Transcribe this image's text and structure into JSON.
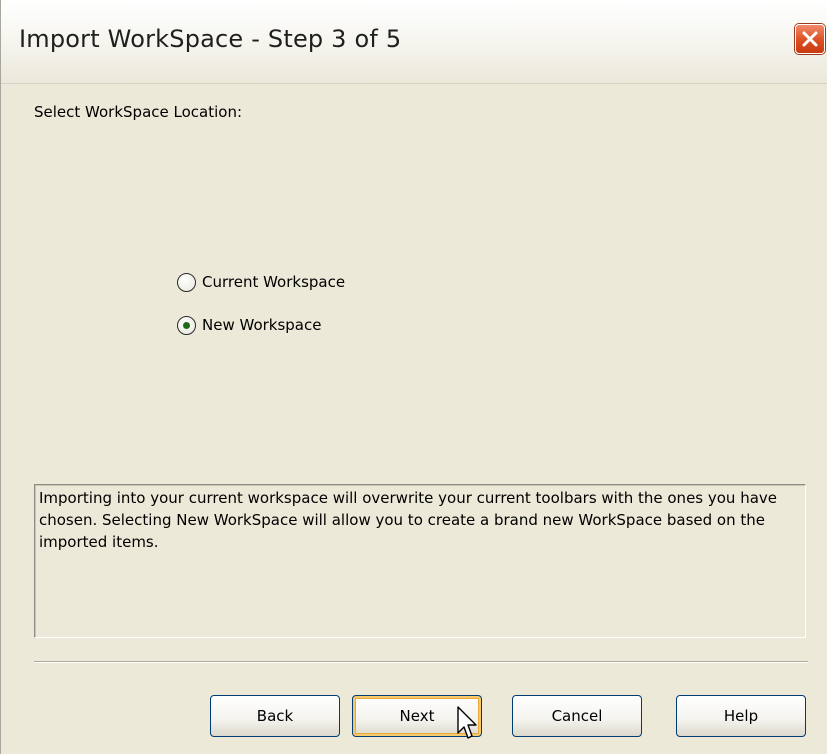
{
  "window": {
    "title": "Import WorkSpace - Step 3 of 5",
    "close_icon": "close-icon"
  },
  "prompt": "Select WorkSpace Location:",
  "location_options": [
    {
      "label": "Current Workspace",
      "selected": false
    },
    {
      "label": "New Workspace",
      "selected": true
    }
  ],
  "description": "Importing into your current workspace will overwrite your current toolbars with the ones you have chosen. Selecting New WorkSpace will allow you to create a brand new WorkSpace based on the imported items.",
  "buttons": {
    "back": "Back",
    "next": "Next",
    "cancel": "Cancel",
    "help": "Help"
  },
  "colors": {
    "dialog_background": "#ece9d8",
    "close_button": "#dd4f22",
    "button_border": "#003c74",
    "default_button_highlight": "#f5c96c",
    "radio_dot": "#1d6b16"
  }
}
